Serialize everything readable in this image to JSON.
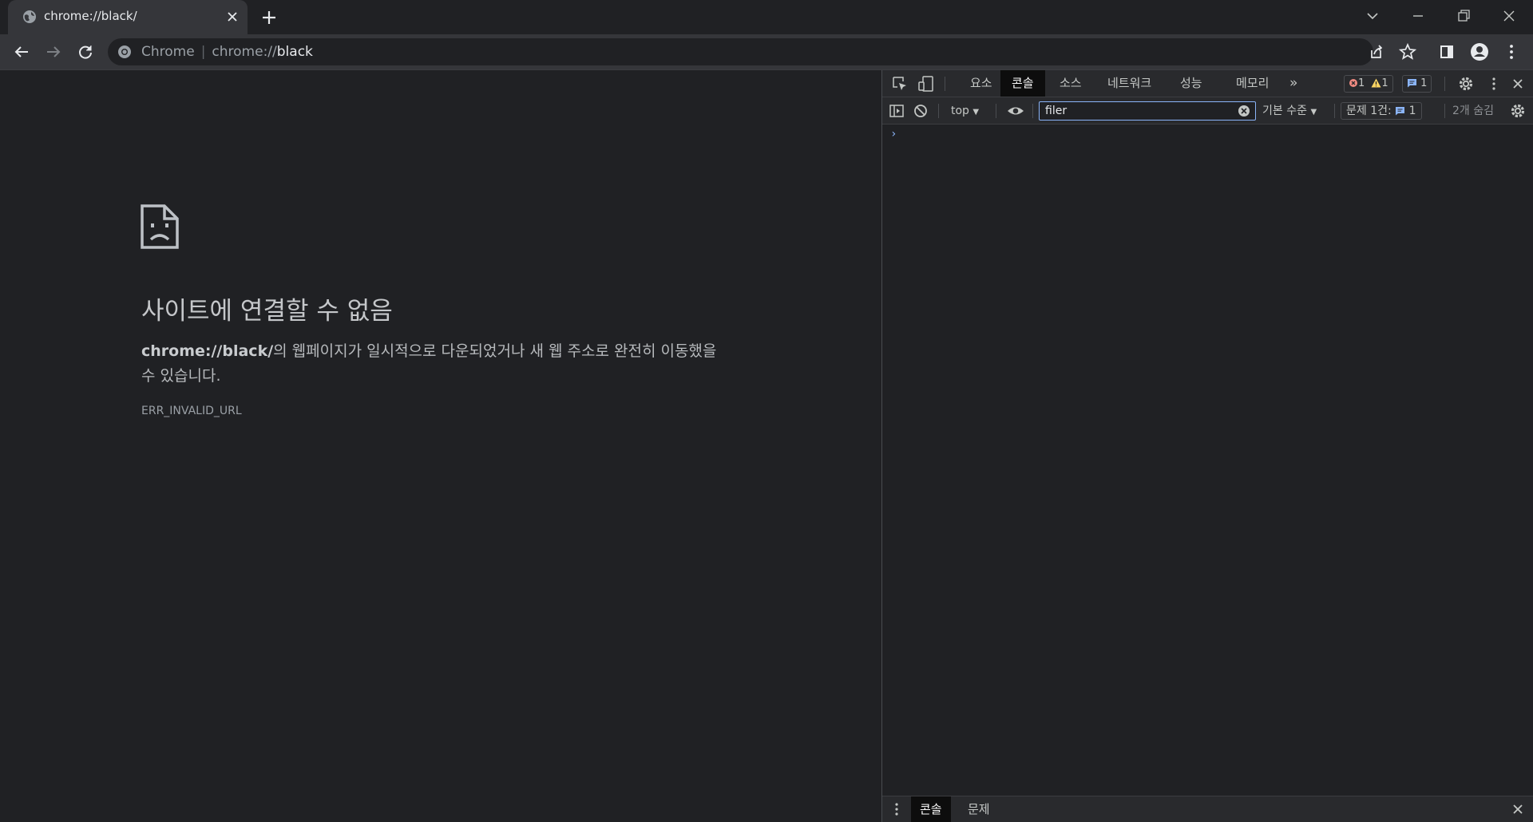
{
  "window": {
    "tab": {
      "title": "chrome://black/"
    },
    "controls": [
      "tab-search",
      "minimize",
      "restore",
      "close"
    ]
  },
  "toolbar": {
    "omnibox": {
      "chip": "Chrome",
      "scheme": "chrome://",
      "host": "black"
    }
  },
  "page": {
    "title": "사이트에 연결할 수 없음",
    "desc_url": "chrome://black/",
    "desc_text": "의 웹페이지가 일시적으로 다운되었거나 새 웹 주소로 완전히 이동했을 수 있습니다.",
    "error_code": "ERR_INVALID_URL"
  },
  "devtools": {
    "tabs": [
      {
        "label": "요소"
      },
      {
        "label": "콘솔",
        "active": true
      },
      {
        "label": "소스"
      },
      {
        "label": "네트워크"
      },
      {
        "label": "성능"
      },
      {
        "label": "메모리"
      }
    ],
    "more_tabs": "»",
    "badges": {
      "errors": "1",
      "warnings": "1",
      "messages": "1"
    },
    "console": {
      "context": "top",
      "filter_value": "filer",
      "levels": "기본 수준",
      "issues_label": "문제 1건:",
      "issues_count": "1",
      "hidden": "2개 숨김",
      "prompt": "›"
    },
    "drawer": {
      "tabs": [
        {
          "label": "콘솔",
          "active": true
        },
        {
          "label": "문제"
        }
      ]
    }
  },
  "colors": {
    "accent": "#8ab4f8",
    "error": "#f28b82",
    "warning": "#fdd663",
    "info": "#8ab4f8"
  }
}
